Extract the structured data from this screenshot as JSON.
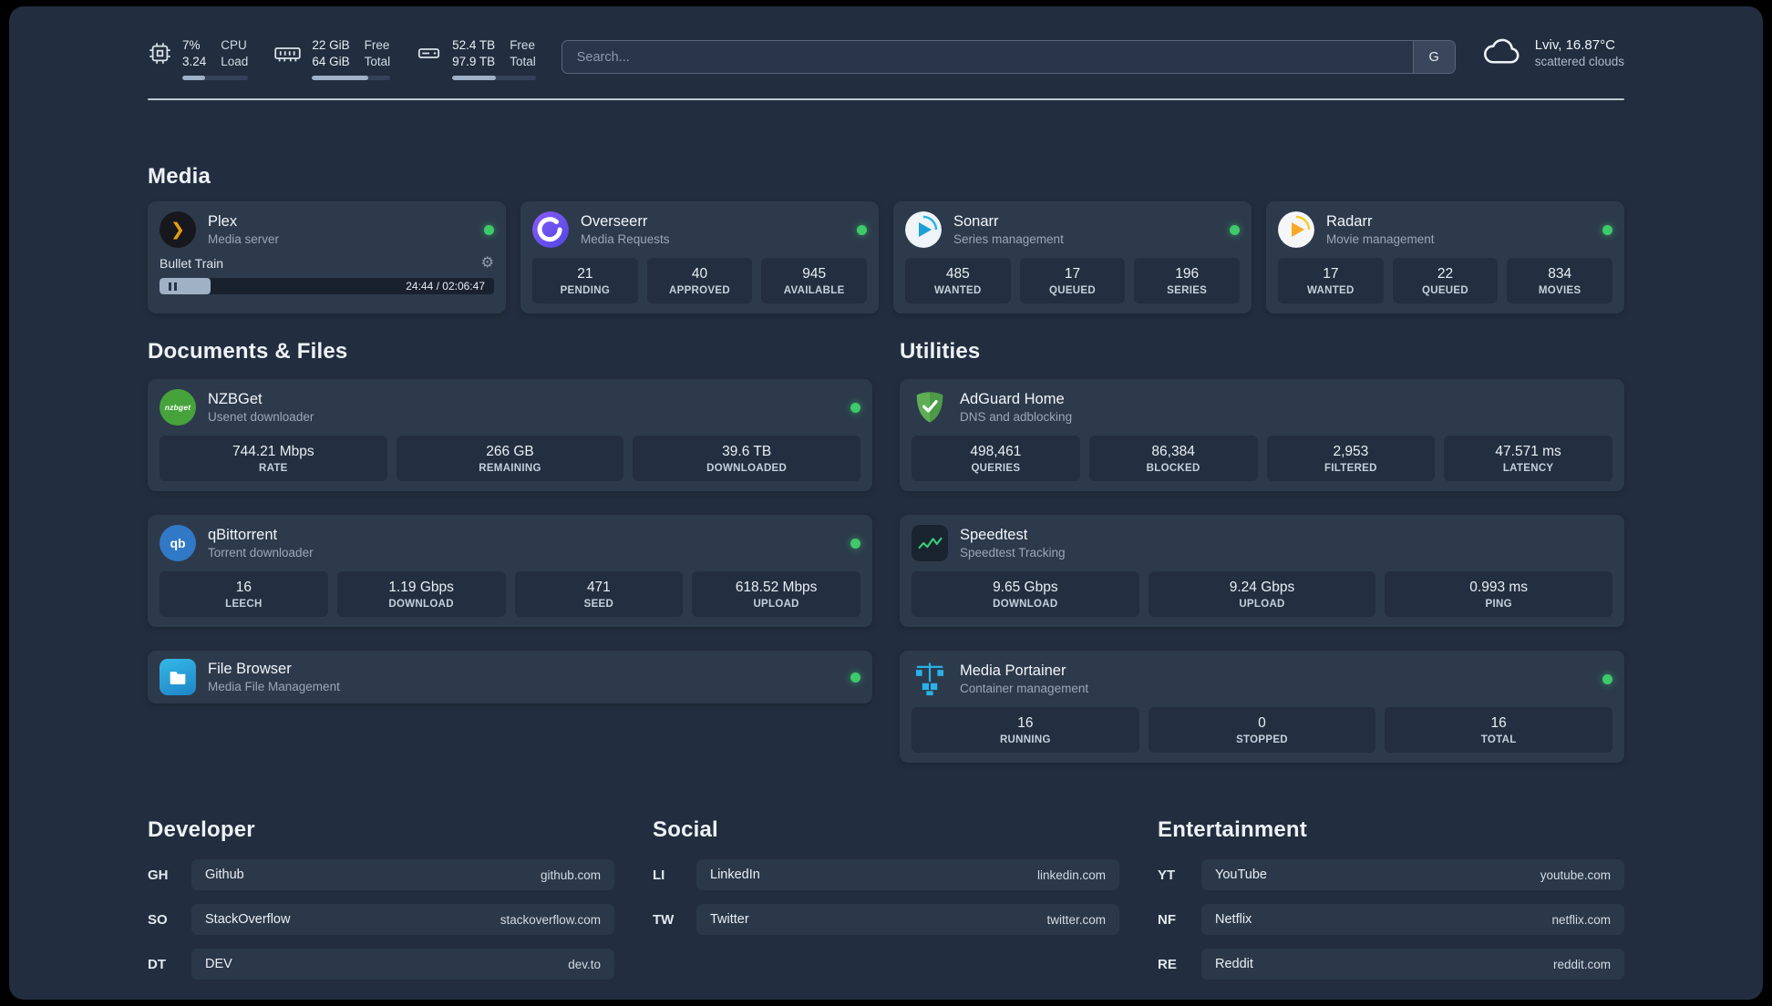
{
  "colors": {
    "status_online": "#3ec96a",
    "panel_bg": "#222e3f",
    "card_bg": "#2d3a4c",
    "accent_bar": "#9fb1c7"
  },
  "topbar": {
    "cpu": {
      "value1": "7%",
      "value2": "3.24",
      "label1": "CPU",
      "label2": "Load"
    },
    "ram": {
      "value1": "22 GiB",
      "value2": "64 GiB",
      "label1": "Free",
      "label2": "Total"
    },
    "disk": {
      "value1": "52.4 TB",
      "value2": "97.9 TB",
      "label1": "Free",
      "label2": "Total"
    },
    "search": {
      "placeholder": "Search...",
      "button_label": "G"
    },
    "weather": {
      "location": "Lviv, 16.87°C",
      "condition": "scattered clouds"
    }
  },
  "media": {
    "title": "Media",
    "plex": {
      "name": "Plex",
      "subtitle": "Media server",
      "now_playing": "Bullet Train",
      "time": "24:44 / 02:06:47"
    },
    "overseerr": {
      "name": "Overseerr",
      "subtitle": "Media Requests",
      "stats": [
        {
          "value": "21",
          "label": "PENDING"
        },
        {
          "value": "40",
          "label": "APPROVED"
        },
        {
          "value": "945",
          "label": "AVAILABLE"
        }
      ]
    },
    "sonarr": {
      "name": "Sonarr",
      "subtitle": "Series management",
      "stats": [
        {
          "value": "485",
          "label": "WANTED"
        },
        {
          "value": "17",
          "label": "QUEUED"
        },
        {
          "value": "196",
          "label": "SERIES"
        }
      ]
    },
    "radarr": {
      "name": "Radarr",
      "subtitle": "Movie management",
      "stats": [
        {
          "value": "17",
          "label": "WANTED"
        },
        {
          "value": "22",
          "label": "QUEUED"
        },
        {
          "value": "834",
          "label": "MOVIES"
        }
      ]
    }
  },
  "documents": {
    "title": "Documents & Files",
    "nzbget": {
      "name": "NZBGet",
      "subtitle": "Usenet downloader",
      "icon_text": "nzbget",
      "stats": [
        {
          "value": "744.21 Mbps",
          "label": "RATE"
        },
        {
          "value": "266 GB",
          "label": "REMAINING"
        },
        {
          "value": "39.6 TB",
          "label": "DOWNLOADED"
        }
      ]
    },
    "qbittorrent": {
      "name": "qBittorrent",
      "subtitle": "Torrent downloader",
      "icon_text": "qb",
      "stats": [
        {
          "value": "16",
          "label": "LEECH"
        },
        {
          "value": "1.19 Gbps",
          "label": "DOWNLOAD"
        },
        {
          "value": "471",
          "label": "SEED"
        },
        {
          "value": "618.52 Mbps",
          "label": "UPLOAD"
        }
      ]
    },
    "filebrowser": {
      "name": "File Browser",
      "subtitle": "Media File Management"
    }
  },
  "utilities": {
    "title": "Utilities",
    "adguard": {
      "name": "AdGuard Home",
      "subtitle": "DNS and adblocking",
      "stats": [
        {
          "value": "498,461",
          "label": "QUERIES"
        },
        {
          "value": "86,384",
          "label": "BLOCKED"
        },
        {
          "value": "2,953",
          "label": "FILTERED"
        },
        {
          "value": "47.571 ms",
          "label": "LATENCY"
        }
      ]
    },
    "speedtest": {
      "name": "Speedtest",
      "subtitle": "Speedtest Tracking",
      "stats": [
        {
          "value": "9.65 Gbps",
          "label": "DOWNLOAD"
        },
        {
          "value": "9.24 Gbps",
          "label": "UPLOAD"
        },
        {
          "value": "0.993 ms",
          "label": "PING"
        }
      ]
    },
    "portainer": {
      "name": "Media Portainer",
      "subtitle": "Container management",
      "stats": [
        {
          "value": "16",
          "label": "RUNNING"
        },
        {
          "value": "0",
          "label": "STOPPED"
        },
        {
          "value": "16",
          "label": "TOTAL"
        }
      ]
    }
  },
  "bookmarks": {
    "developer": {
      "title": "Developer",
      "items": [
        {
          "abbr": "GH",
          "name": "Github",
          "url": "github.com"
        },
        {
          "abbr": "SO",
          "name": "StackOverflow",
          "url": "stackoverflow.com"
        },
        {
          "abbr": "DT",
          "name": "DEV",
          "url": "dev.to"
        }
      ]
    },
    "social": {
      "title": "Social",
      "items": [
        {
          "abbr": "LI",
          "name": "LinkedIn",
          "url": "linkedin.com"
        },
        {
          "abbr": "TW",
          "name": "Twitter",
          "url": "twitter.com"
        }
      ]
    },
    "entertainment": {
      "title": "Entertainment",
      "items": [
        {
          "abbr": "YT",
          "name": "YouTube",
          "url": "youtube.com"
        },
        {
          "abbr": "NF",
          "name": "Netflix",
          "url": "netflix.com"
        },
        {
          "abbr": "RE",
          "name": "Reddit",
          "url": "reddit.com"
        }
      ]
    }
  }
}
